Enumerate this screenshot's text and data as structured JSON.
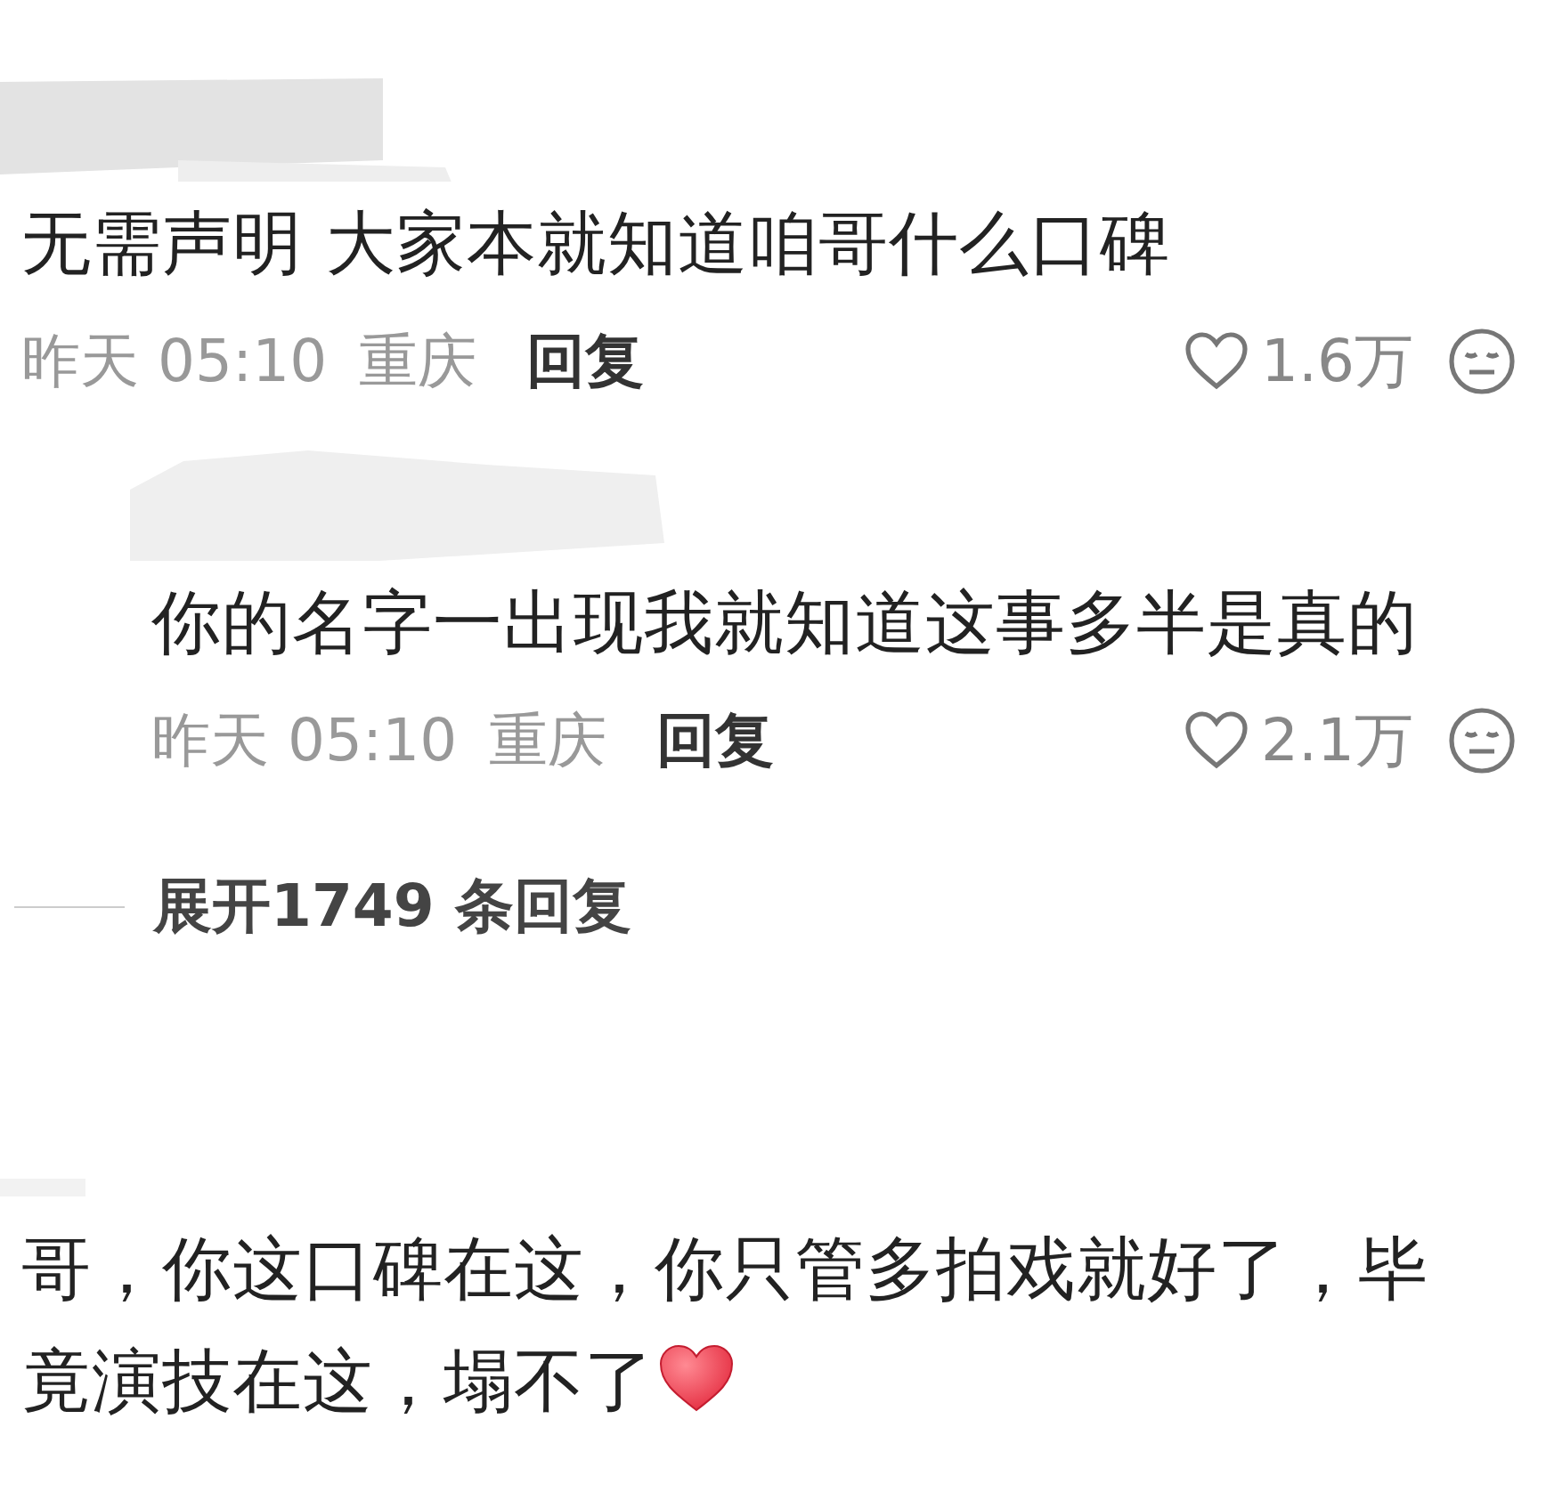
{
  "comments": [
    {
      "kind": "comment",
      "text": "无需声明 大家本就知道咱哥什么口碑",
      "time": "昨天 05:10",
      "location": "重庆",
      "reply": "回复",
      "likes": "1.6万"
    },
    {
      "kind": "reply",
      "text": "你的名字一出现我就知道这事多半是真的",
      "time": "昨天 05:10",
      "location": "重庆",
      "reply": "回复",
      "likes": "2.1万"
    },
    {
      "kind": "expand",
      "text": "展开1749 条回复"
    },
    {
      "kind": "comment",
      "text": "哥，你这口碑在这，你只管多拍戏就好了，毕竟演技在这，塌不了",
      "heart_emoji": true
    }
  ]
}
